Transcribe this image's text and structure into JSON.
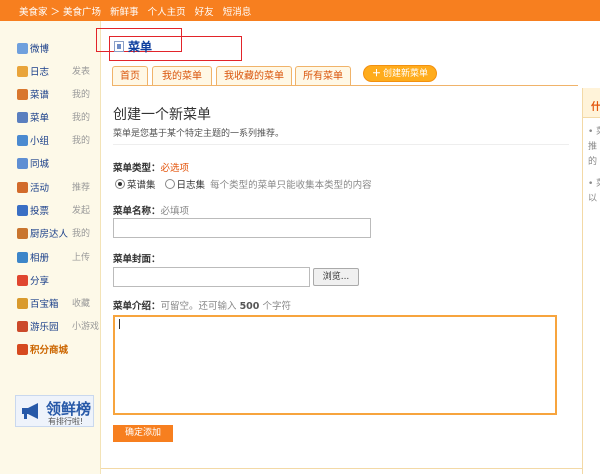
{
  "topbar": {
    "crumb": "美食家 ＞ 美食广场",
    "links": [
      "新鲜事",
      "个人主页",
      "好友",
      "短消息"
    ]
  },
  "sidebar": {
    "items": [
      {
        "label": "微博",
        "sub": "",
        "icon": "weibo-icon",
        "color": "#6fa0dd"
      },
      {
        "label": "日志",
        "sub": "发表",
        "icon": "blog-icon",
        "color": "#e9a43a"
      },
      {
        "label": "菜谱",
        "sub": "我的",
        "icon": "recipe-icon",
        "color": "#d9772d"
      },
      {
        "label": "菜单",
        "sub": "我的",
        "icon": "menu-icon",
        "color": "#5a7fbf"
      },
      {
        "label": "小组",
        "sub": "我的",
        "icon": "group-icon",
        "color": "#4b8ad0"
      },
      {
        "label": "同城",
        "sub": "",
        "icon": "city-icon",
        "color": "#5f8fd3"
      },
      {
        "label": "活动",
        "sub": "推荐",
        "icon": "activity-icon",
        "color": "#d26b2b"
      },
      {
        "label": "投票",
        "sub": "发起",
        "icon": "vote-icon",
        "color": "#3a6fc4"
      },
      {
        "label": "厨房达人",
        "sub": "我的",
        "icon": "chef-icon",
        "color": "#c9752e"
      },
      {
        "label": "相册",
        "sub": "上传",
        "icon": "album-icon",
        "color": "#3d86c9"
      },
      {
        "label": "分享",
        "sub": "",
        "icon": "share-icon",
        "color": "#e0462f"
      },
      {
        "label": "百宝箱",
        "sub": "收藏",
        "icon": "treasure-icon",
        "color": "#d99a2c"
      },
      {
        "label": "游乐园",
        "sub": "小游戏",
        "icon": "game-icon",
        "color": "#cc4a2a"
      },
      {
        "label": "积分商城",
        "sub": "",
        "icon": "points-icon",
        "color": "#d64a1f"
      }
    ],
    "banner": {
      "big": "领鲜榜",
      "small": "有排行啦!"
    }
  },
  "header": {
    "title": "菜单",
    "tabs": [
      "首页",
      "我的菜单",
      "我收藏的菜单",
      "所有菜单"
    ],
    "create_button": "创建新菜单"
  },
  "form": {
    "heading": "创建一个新菜单",
    "description": "菜单是您基于某个特定主题的一系列推荐。",
    "type_label": "菜单类型：",
    "type_required": "必选项",
    "type_options": [
      "菜谱集",
      "日志集"
    ],
    "type_hint": "每个类型的菜单只能收集本类型的内容",
    "name_label": "菜单名称：",
    "name_required": "必填项",
    "cover_label": "菜单封面：",
    "browse_button": "浏览...",
    "intro_label": "菜单介绍：",
    "intro_hint_prefix": "可留空。还可输入",
    "intro_hint_num": "500",
    "intro_hint_suffix": "个字符",
    "submit_button": "确定添加"
  },
  "right_panel": {
    "head": "什",
    "lines": [
      "• 菜",
      "推",
      "的",
      "• 菜",
      "以"
    ]
  },
  "colors": {
    "accent": "#f77f1f",
    "link": "#1a3f8a",
    "title": "#0d3e9e"
  }
}
